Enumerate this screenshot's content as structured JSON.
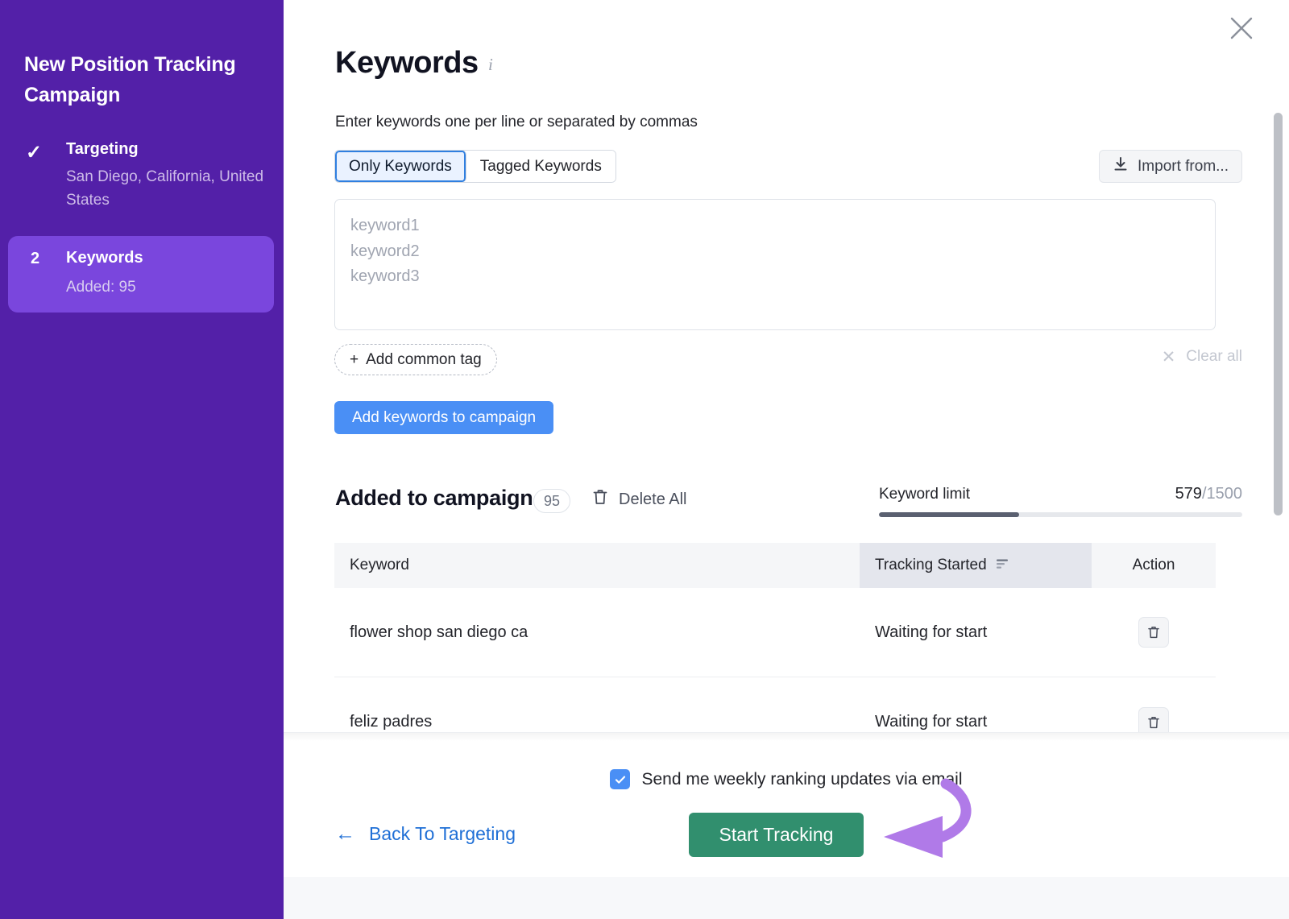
{
  "sidebar": {
    "title": "New Position Tracking Campaign",
    "accent_color": "#5320a8",
    "active_color": "#7a46dd",
    "steps": [
      {
        "marker": "✓",
        "label": "Targeting",
        "sub": "San Diego, California, United States",
        "state": "completed"
      },
      {
        "marker": "2",
        "label": "Keywords",
        "sub": "Added: 95",
        "state": "active"
      }
    ]
  },
  "main": {
    "title": "Keywords",
    "title_info_icon": "info-icon",
    "close_icon": "close-icon",
    "hint": "Enter keywords one per line or separated by commas",
    "toggle": {
      "options": [
        "Only Keywords",
        "Tagged Keywords"
      ],
      "selected": "Only Keywords",
      "active_border_color": "#2f7fe0",
      "active_bg_color": "#eaf2ff"
    },
    "import": {
      "label": "Import from...",
      "icon": "download-icon"
    },
    "textarea": {
      "value": "",
      "placeholder": "keyword1\nkeyword2\nkeyword3"
    },
    "add_common_tag": {
      "label": "Add common tag",
      "icon": "plus-icon"
    },
    "clear_all": {
      "label": "Clear all",
      "icon": "close-icon"
    },
    "add_keywords_button": {
      "label": "Add keywords to campaign",
      "color": "#4a8ff5"
    },
    "added_section": {
      "title": "Added to campaign",
      "count": "95",
      "delete_all": {
        "label": "Delete All",
        "icon": "trash-icon"
      }
    },
    "keyword_limit": {
      "label": "Keyword limit",
      "used": "579",
      "separator": "/",
      "total": "1500",
      "percent": 38.6
    },
    "table": {
      "columns": [
        "Keyword",
        "Tracking Started",
        "Action"
      ],
      "sorted_column": "Tracking Started",
      "sort_icon": "sort-descending-icon",
      "rows": [
        {
          "keyword": "flower shop san diego ca",
          "tracking_started": "Waiting for start",
          "action_icon": "trash-icon"
        },
        {
          "keyword": "feliz padres",
          "tracking_started": "Waiting for start",
          "action_icon": "trash-icon"
        }
      ]
    }
  },
  "footer": {
    "email_option": {
      "label": "Send me weekly ranking updates via email",
      "checked": true,
      "color": "#4a8ff5"
    },
    "back_link": {
      "label": "Back To Targeting",
      "icon": "arrow-left-icon",
      "color": "#1f6fd6"
    },
    "start_button": {
      "label": "Start Tracking",
      "color": "#318f6e"
    },
    "annotation": {
      "type": "curved-arrow",
      "color": "#b07ae8",
      "points_to": "start-button"
    }
  }
}
